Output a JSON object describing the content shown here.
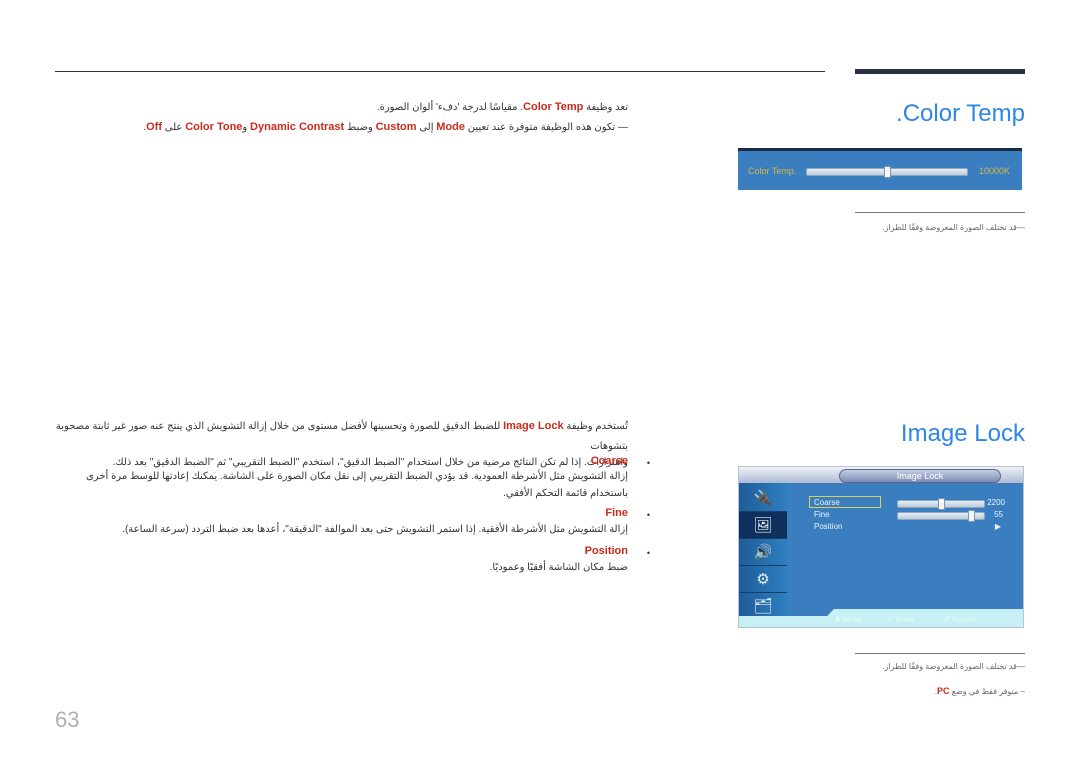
{
  "header": {
    "page_number": "63"
  },
  "color_temp": {
    "title": ".Color Temp",
    "description_parts": {
      "p1_prefix": "تعد وظيفة",
      "p1_keyword": "Color Temp",
      "p1_suffix": ". مقياسًا لدرجة 'دفء' ألوان الصورة.",
      "p2_dash": "—",
      "p2_text1": "تكون هذه الوظيفة متوفرة عند تعيين",
      "p2_kw1": "Mode",
      "p2_text2": "إلى",
      "p2_kw2": "Custom",
      "p2_text3": "وضبط",
      "p2_kw3": "Dynamic Contrast",
      "p2_text4": "و",
      "p2_kw4": "Color Tone",
      "p2_text5": "على",
      "p2_kw5": "Off",
      "p2_end": "."
    },
    "osd": {
      "label": "Color Temp.",
      "value_text": "10000K",
      "slider_fraction": 0.5
    },
    "note": "—قد تختلف الصورة المعروضة وفقًا للطراز."
  },
  "image_lock": {
    "title": "Image Lock",
    "intro_parts": {
      "prefix": "تُستخدم وظيفة",
      "keyword": "Image Lock",
      "line1_rest": "للضبط الدقيق للصورة وتحسينها لأفضل مستوى من خلال إزالة التشويش الذي ينتج عنه صور غير ثابتة مصحوبة بتشوهات",
      "line2": "واهتزازات. إذا لم تكن النتائج مرضية من خلال استخدام \"الضبط الدقيق\"، استخدم \"الضبط التقريبي\" ثم \"الضبط الدقيق\" بعد ذلك."
    },
    "bullets": [
      {
        "heading": "Coarse",
        "text": "إزالة التشويش مثل الأشرطة العمودية. قد يؤدي الضبط التقريبي إلى نقل مكان الصورة على الشاشة. يمكنك إعادتها للوسط مرة أخرى باستخدام قائمة التحكم الأفقي."
      },
      {
        "heading": "Fine",
        "text": "إزالة التشويش مثل الأشرطة الأفقية. إذا استمر التشويش حتى بعد الموالفة \"الدقيقة\"، أعدها بعد ضبط التردد (سرعة الساعة)."
      },
      {
        "heading": "Position",
        "text": "ضبط مكان الشاشة أفقيًا وعموديًا."
      }
    ],
    "osd": {
      "title": "Image Lock",
      "side_icons": [
        "input-icon",
        "picture-icon",
        "sound-icon",
        "setup-icon",
        "multi-control-icon"
      ],
      "active_index": 1,
      "rows": [
        {
          "label": "Coarse",
          "value_text": "2200",
          "slider_fraction": 0.5,
          "selected": true
        },
        {
          "label": "Fine",
          "value_text": "55",
          "slider_fraction": 0.87,
          "selected": false
        },
        {
          "label": "Position",
          "value_text": "▶",
          "selected": false
        }
      ],
      "hints": [
        {
          "icon": "⬍",
          "label": "Move"
        },
        {
          "icon": "⏎",
          "label": "Enter"
        },
        {
          "icon": "↺",
          "label": "Return"
        }
      ]
    },
    "notes": [
      {
        "text": "—قد تختلف الصورة المعروضة وفقًا للطراز."
      },
      {
        "prefix": "– متوفر فقط في وضع",
        "keyword": "PC",
        "suffix": "."
      }
    ]
  }
}
